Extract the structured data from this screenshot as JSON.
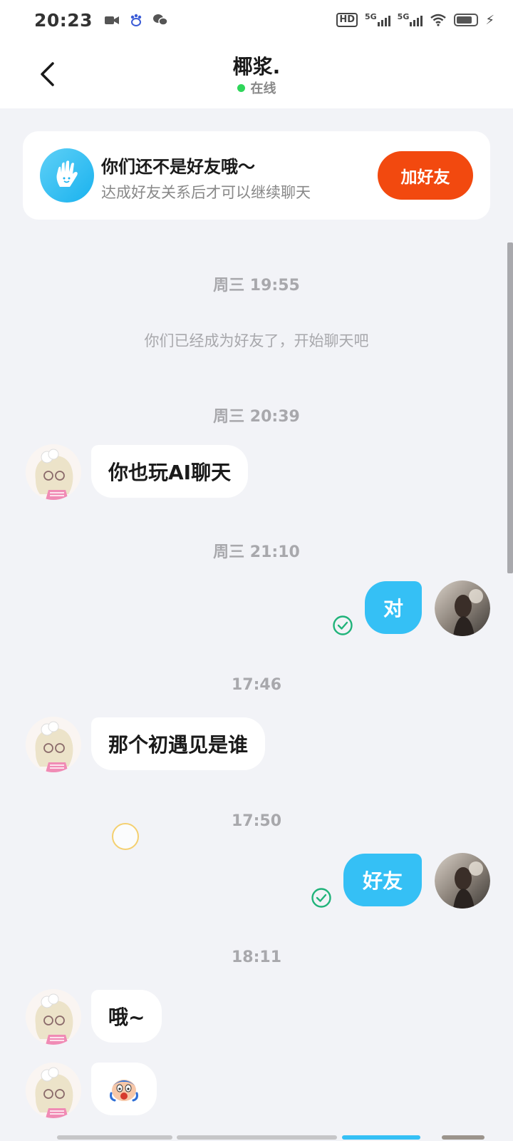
{
  "status_bar": {
    "time": "20:23",
    "left_icons": [
      "video-icon",
      "baidu-icon",
      "wechat-icon"
    ],
    "hd_label": "HD",
    "network_1": "5G",
    "network_2": "5G"
  },
  "header": {
    "title": "椰浆.",
    "status": "在线",
    "online_color": "#2fd65a"
  },
  "friend_banner": {
    "title": "你们还不是好友哦～",
    "subtitle": "达成好友关系后才可以继续聊天",
    "button_label": "加好友",
    "button_color": "#f2490f"
  },
  "chat": {
    "system_message": "你们已经成为好友了，开始聊天吧",
    "timestamps": {
      "t1": "周三 19:55",
      "t2": "周三 20:39",
      "t3": "周三 21:10",
      "t4": "17:46",
      "t5": "17:50",
      "t6": "18:11"
    },
    "messages": [
      {
        "side": "left",
        "text": "你也玩AI聊天"
      },
      {
        "side": "right",
        "text": "对",
        "status": "read"
      },
      {
        "side": "left",
        "text": "那个初遇见是谁"
      },
      {
        "side": "right",
        "text": "好友",
        "status": "read"
      },
      {
        "side": "left",
        "text": "哦~"
      },
      {
        "side": "left",
        "text": "",
        "sticker": "scared-face-sticker"
      }
    ],
    "outgoing_bubble_color": "#35c0f5"
  }
}
